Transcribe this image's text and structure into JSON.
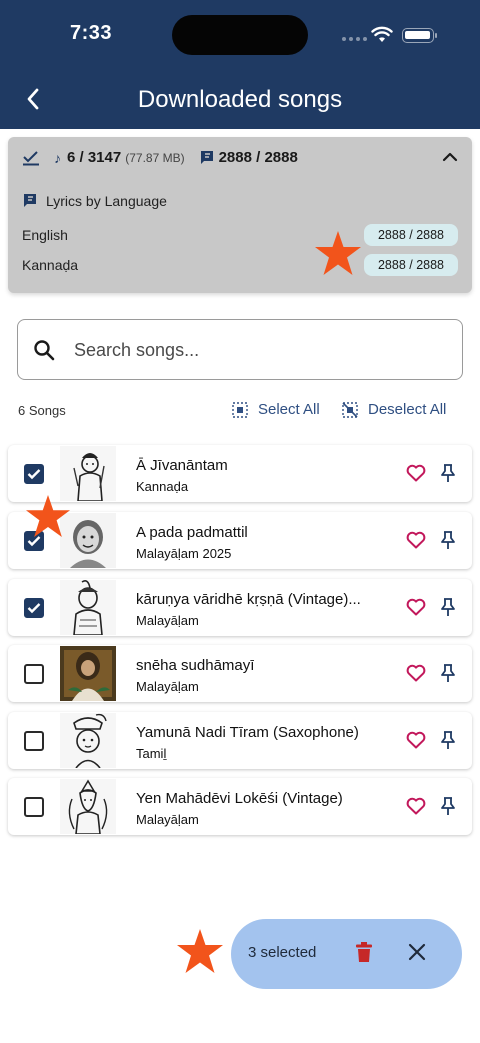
{
  "status_bar": {
    "time": "7:33"
  },
  "header": {
    "title": "Downloaded songs"
  },
  "summary": {
    "downloaded": "6 / 3147",
    "size": "(77.87 MB)",
    "lyrics_count": "2888 / 2888",
    "lyrics_by_language_label": "Lyrics by Language",
    "languages": [
      {
        "name": "English",
        "count": "2888 / 2888"
      },
      {
        "name": "Kannaḍa",
        "count": "2888 / 2888"
      }
    ]
  },
  "search": {
    "placeholder": "Search songs..."
  },
  "list_header": {
    "count": "6 Songs",
    "select_all": "Select All",
    "deselect_all": "Deselect All"
  },
  "songs": [
    {
      "title": "Ā Jīvanāntam",
      "subtitle": "Kannaḍa",
      "checked": true
    },
    {
      "title": "A pada padmattil",
      "subtitle": "Malayāḷam 2025",
      "checked": true
    },
    {
      "title": "kāruṇya vāridhē kṛṣṇā (Vintage)...",
      "subtitle": "Malayāḷam",
      "checked": true
    },
    {
      "title": "snēha sudhāmayī",
      "subtitle": "Malayāḷam",
      "checked": false
    },
    {
      "title": "Yamunā Nadi Tīram (Saxophone)",
      "subtitle": "Tamiḻ",
      "checked": false
    },
    {
      "title": "Yen Mahādēvi Lokēśi (Vintage)",
      "subtitle": "Malayāḷam",
      "checked": false
    }
  ],
  "selection_bar": {
    "label": "3 selected"
  },
  "colors": {
    "header": "#1f3a63",
    "accent": "#2f4f82",
    "heart": "#c2185b",
    "trash": "#c62828",
    "fab": "#a3c3ee",
    "star": "#f2541b"
  }
}
